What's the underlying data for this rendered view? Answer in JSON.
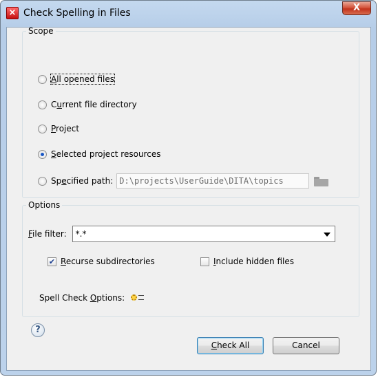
{
  "window": {
    "title": "Check Spelling in Files",
    "close_glyph": "X"
  },
  "scope": {
    "legend": "Scope",
    "options": [
      {
        "pre": "",
        "mn": "A",
        "post": "ll opened files",
        "selected": false
      },
      {
        "pre": "C",
        "mn": "u",
        "post": "rrent file directory",
        "selected": false
      },
      {
        "pre": "",
        "mn": "P",
        "post": "roject",
        "selected": false
      },
      {
        "pre": "",
        "mn": "S",
        "post": "elected project resources",
        "selected": true
      },
      {
        "pre": "Sp",
        "mn": "e",
        "post": "cified path:",
        "selected": false
      }
    ],
    "specified_path_value": "D:\\projects\\UserGuide\\DITA\\topics"
  },
  "options": {
    "legend": "Options",
    "file_filter": {
      "mn": "F",
      "post": "ile filter:",
      "value": "*.*"
    },
    "recurse": {
      "mn": "R",
      "post": "ecurse subdirectories",
      "checked": true
    },
    "hidden": {
      "mn": "I",
      "post": "nclude hidden files",
      "checked": false
    },
    "spell_check": {
      "pre": "Spell Check ",
      "mn": "O",
      "post": "ptions:"
    }
  },
  "footer": {
    "help_glyph": "?",
    "check_all": {
      "mn": "C",
      "post": "heck All"
    },
    "cancel": "Cancel"
  },
  "icons": [
    "app-icon",
    "close-icon",
    "folder-icon",
    "gear-icon",
    "help-icon"
  ]
}
